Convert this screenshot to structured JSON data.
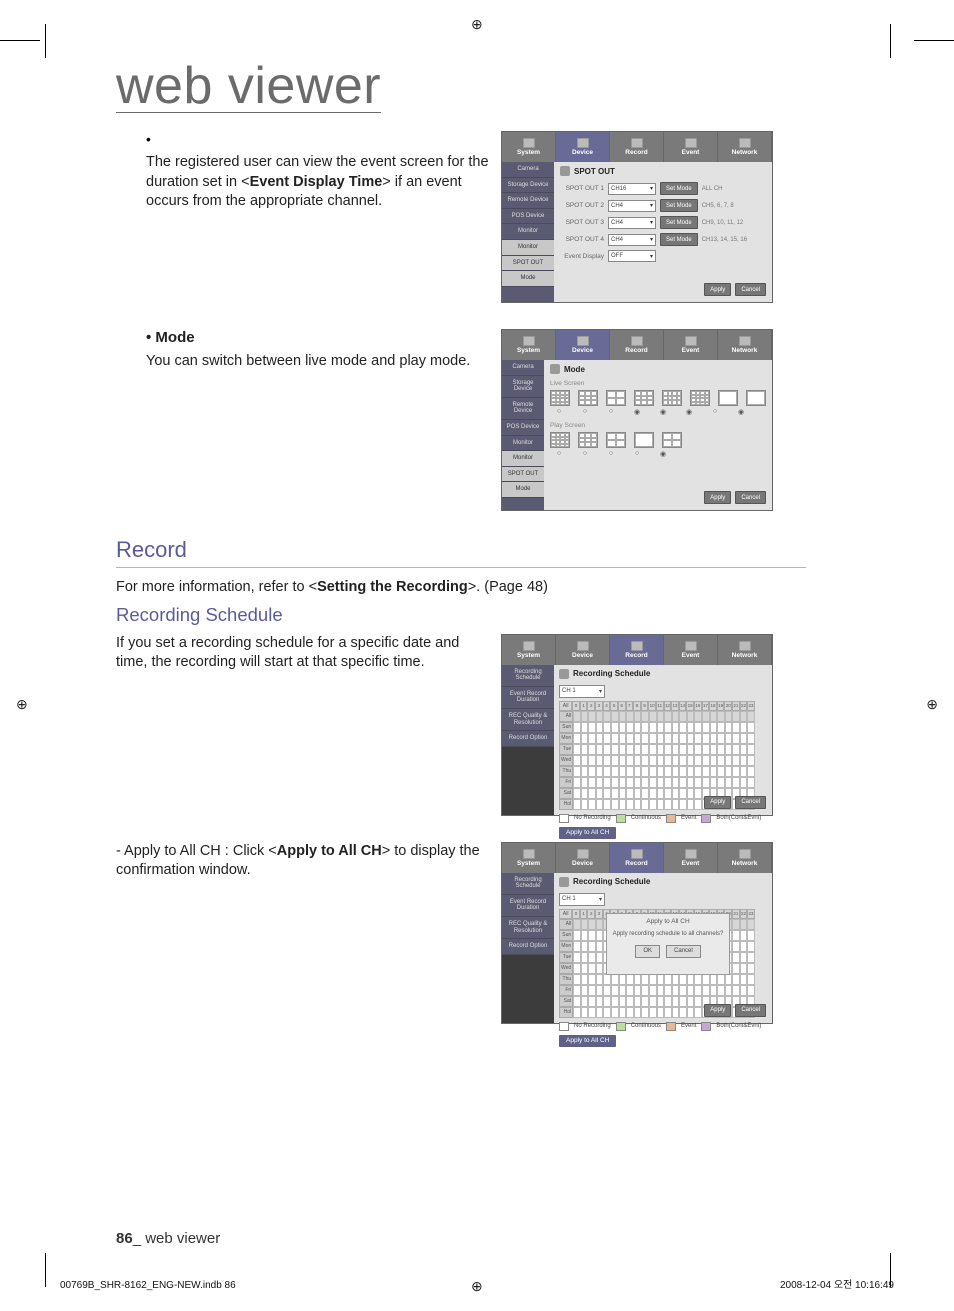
{
  "header": {
    "title": "web viewer"
  },
  "bullet1": {
    "text": "The registered user can view the event screen for the duration set in <",
    "bold": "Event Display Time",
    "rest": "> if an event occurs from the appropriate channel."
  },
  "mode": {
    "heading": "Mode",
    "text": "You can switch between live mode and play mode."
  },
  "record": {
    "heading": "Record",
    "intro_pre": "For more information, refer to <",
    "intro_bold": "Setting the Recording",
    "intro_post": ">. (Page 48)"
  },
  "recsched": {
    "heading": "Recording Schedule",
    "text": "If you set a recording schedule for a specific date and time, the recording will start at that specific time."
  },
  "applyall": {
    "pre": "- Apply to All CH : Click <",
    "bold": "Apply to All CH",
    "post": "> to display the confirmation window."
  },
  "footer": {
    "page_no": "86",
    "label": "_ web viewer"
  },
  "indd": {
    "left": "00769B_SHR-8162_ENG-NEW.indb   86",
    "right": "2008-12-04   오전 10:16:49"
  },
  "mock_tabs": [
    "System",
    "Device",
    "Record",
    "Event",
    "Network"
  ],
  "mock_spot": {
    "title": "SPOT OUT",
    "sidebar": [
      "Camera",
      "Storage Device",
      "Remote Device",
      "POS Device",
      "Monitor",
      "Monitor",
      "SPOT OUT",
      "Mode"
    ],
    "rows": [
      {
        "label": "SPOT OUT 1",
        "sel": "CH16",
        "btn": "Set Mode",
        "ch": "ALL CH"
      },
      {
        "label": "SPOT OUT 2",
        "sel": "CH4",
        "btn": "Set Mode",
        "ch": "CH5, 6, 7, 8"
      },
      {
        "label": "SPOT OUT 3",
        "sel": "CH4",
        "btn": "Set Mode",
        "ch": "CH9, 10, 11, 12"
      },
      {
        "label": "SPOT OUT 4",
        "sel": "CH4",
        "btn": "Set Mode",
        "ch": "CH13, 14, 15, 16"
      }
    ],
    "event_display": {
      "label": "Event Display",
      "sel": "OFF"
    },
    "apply": "Apply",
    "cancel": "Cancel"
  },
  "mock_mode": {
    "title": "Mode",
    "sidebar": [
      "Camera",
      "Storage Device",
      "Remote Device",
      "POS Device",
      "Monitor",
      "Monitor",
      "SPOT OUT",
      "Mode"
    ],
    "live_label": "Live Screen",
    "play_label": "Play Screen",
    "apply": "Apply",
    "cancel": "Cancel"
  },
  "mock_recsched": {
    "title": "Recording Schedule",
    "sidebar": [
      "Recording Schedule",
      "Event Record Duration",
      "REC Quality & Resolution",
      "Record Option"
    ],
    "ch_sel": "CH 1",
    "hours": [
      "All",
      "0",
      "1",
      "2",
      "3",
      "4",
      "5",
      "6",
      "7",
      "8",
      "9",
      "10",
      "11",
      "12",
      "13",
      "14",
      "15",
      "16",
      "17",
      "18",
      "19",
      "20",
      "21",
      "22",
      "23"
    ],
    "days": [
      "All",
      "Sun",
      "Mon",
      "Tue",
      "Wed",
      "Thu",
      "Fri",
      "Sat",
      "Hol"
    ],
    "legend": [
      {
        "label": "No Recording",
        "color": "#fff"
      },
      {
        "label": "Continuous",
        "color": "#b8e09a"
      },
      {
        "label": "Event",
        "color": "#e8b890"
      },
      {
        "label": "Both(Cont&Evnt)",
        "color": "#c2a8d4"
      }
    ],
    "apply_all": "Apply to All CH",
    "apply": "Apply",
    "cancel": "Cancel"
  },
  "mock_dialog": {
    "title": "Apply to All CH",
    "msg": "Apply recording schedule to all channels?",
    "ok": "OK",
    "cancel": "Cancel"
  }
}
